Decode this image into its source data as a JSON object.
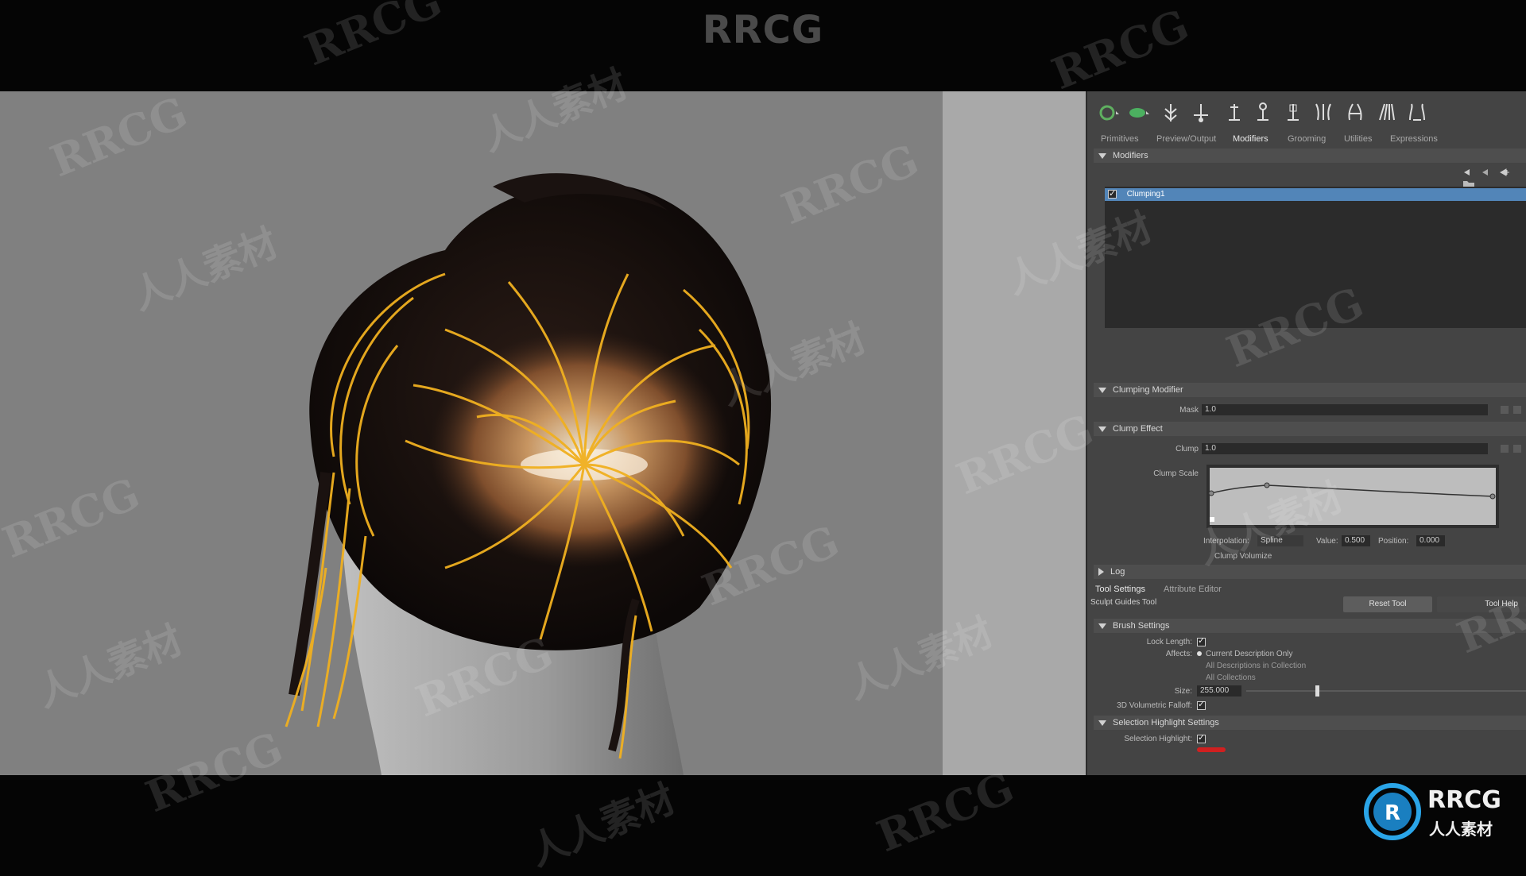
{
  "watermark": {
    "text": "RRCG",
    "cn_text": "人人素材"
  },
  "toolbar": {
    "icons": [
      "guide-select-icon",
      "description-icon",
      "add-guide-icon",
      "move-guide-icon",
      "length-guide-icon",
      "rebuild-guide-icon",
      "bind-guide-icon",
      "curve-guide-icon",
      "sculpt-guide-icon",
      "clump-guide-icon",
      "comb-guide-icon",
      "cut-guide-icon"
    ]
  },
  "tabs": [
    "Primitives",
    "Preview/Output",
    "Modifiers",
    "Grooming",
    "Utilities",
    "Expressions"
  ],
  "active_tab": "Modifiers",
  "modifiers": {
    "section_label": "Modifiers",
    "items": [
      {
        "label": "Clumping1",
        "checked": true
      }
    ]
  },
  "clumping_modifier": {
    "section_label": "Clumping Modifier",
    "mask_label": "Mask",
    "mask_value": "1.0"
  },
  "clump_effect": {
    "section_label": "Clump Effect",
    "clump_label": "Clump",
    "clump_value": "1.0",
    "clump_scale_label": "Clump Scale",
    "interpolation_label": "Interpolation:",
    "interpolation_value": "Spline",
    "value_label": "Value:",
    "value_value": "0.500",
    "position_label": "Position:",
    "position_value": "0.000",
    "clump_volumize_label": "Clump Volumize"
  },
  "log": {
    "section_label": "Log"
  },
  "tool_tabs": [
    "Tool Settings",
    "Attribute Editor"
  ],
  "tool": {
    "name": "Sculpt Guides Tool",
    "reset_label": "Reset Tool",
    "help_label": "Tool Help"
  },
  "brush_settings": {
    "section_label": "Brush Settings",
    "lock_length_label": "Lock Length:",
    "affects_label": "Affects:",
    "affects_options": [
      "Current Description Only",
      "All Descriptions in Collection",
      "All Collections"
    ],
    "size_label": "Size:",
    "size_value": "255.000",
    "volumetric_label": "3D Volumetric Falloff:"
  },
  "selection_highlight": {
    "section_label": "Selection Highlight Settings",
    "highlight_label": "Selection Highlight:"
  },
  "logo": {
    "text": "RRCG",
    "sub": "人人素材"
  },
  "colors": {
    "guide": "#f0b020",
    "selection": "#5285b8",
    "panel": "#444444"
  }
}
